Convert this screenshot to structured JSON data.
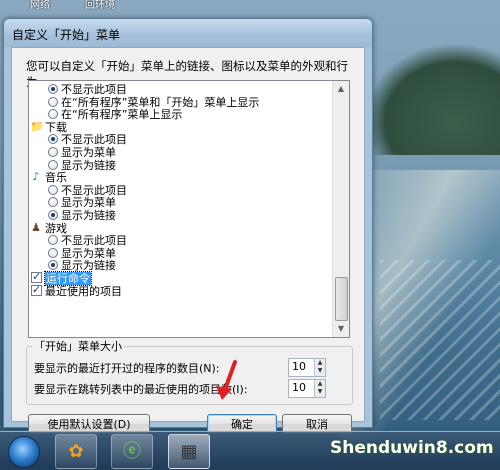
{
  "window": {
    "title": "自定义「开始」菜单",
    "description": "您可以自定义「开始」菜单上的链接、图标以及菜单的外观和行为。"
  },
  "list": {
    "rows": [
      {
        "kind": "radio",
        "label": "不显示此项目",
        "checked": true
      },
      {
        "kind": "radio",
        "label": "在“所有程序”菜单和「开始」菜单上显示",
        "checked": false
      },
      {
        "kind": "radio",
        "label": "在“所有程序”菜单上显示",
        "checked": false
      },
      {
        "kind": "category",
        "label": "下载",
        "icon": "download-folder-icon"
      },
      {
        "kind": "radio",
        "label": "不显示此项目",
        "checked": true
      },
      {
        "kind": "radio",
        "label": "显示为菜单",
        "checked": false
      },
      {
        "kind": "radio",
        "label": "显示为链接",
        "checked": false
      },
      {
        "kind": "category",
        "label": "音乐",
        "icon": "music-note-icon"
      },
      {
        "kind": "radio",
        "label": "不显示此项目",
        "checked": false
      },
      {
        "kind": "radio",
        "label": "显示为菜单",
        "checked": false
      },
      {
        "kind": "radio",
        "label": "显示为链接",
        "checked": true
      },
      {
        "kind": "category",
        "label": "游戏",
        "icon": "games-icon"
      },
      {
        "kind": "radio",
        "label": "不显示此项目",
        "checked": false
      },
      {
        "kind": "radio",
        "label": "显示为菜单",
        "checked": false
      },
      {
        "kind": "radio",
        "label": "显示为链接",
        "checked": true
      },
      {
        "kind": "checkbox",
        "label": "运行命令",
        "checked": true,
        "selected": true
      },
      {
        "kind": "checkbox",
        "label": "最近使用的项目",
        "checked": true
      }
    ]
  },
  "start_menu_size": {
    "legend": "「开始」菜单大小",
    "recent_programs_label": "要显示的最近打开过的程序的数目(N):",
    "recent_programs_value": "10",
    "jump_list_label": "要显示在跳转列表中的最近使用的项目数(I):",
    "jump_list_value": "10"
  },
  "buttons": {
    "defaults": "使用默认设置(D)",
    "ok": "确定",
    "cancel": "取消"
  },
  "desktop": {
    "icon_label_1": "网络",
    "icon_label_2": "回环境"
  },
  "watermark": "Shenduwin8.com",
  "colors": {
    "selection": "#3399ff",
    "arrow": "#e02020"
  }
}
